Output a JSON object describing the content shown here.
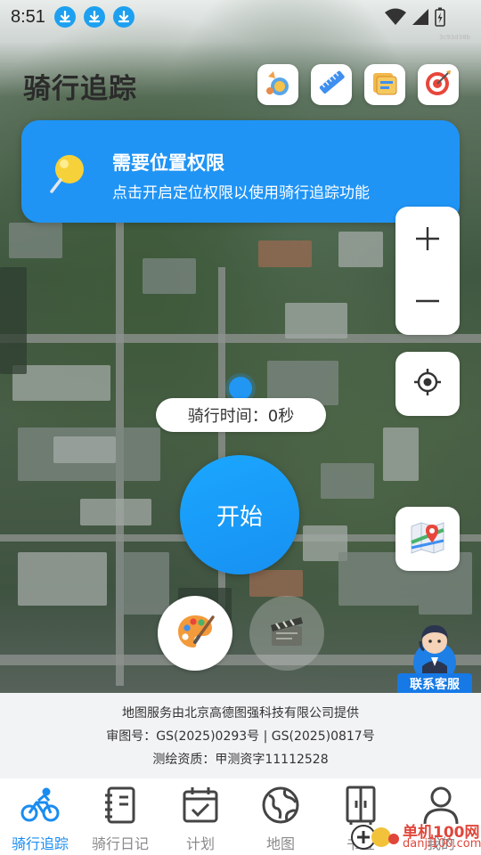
{
  "status_bar": {
    "time": "8:51",
    "icons": [
      "download-icon",
      "download-icon",
      "download-icon",
      "wifi-icon",
      "signal-icon",
      "battery-charging-icon"
    ],
    "tiny_text": "3c93d38b"
  },
  "header": {
    "title": "骑行追踪",
    "tools": [
      "achievement-icon",
      "ruler-icon",
      "folder-icon",
      "target-icon"
    ]
  },
  "banner": {
    "title": "需要位置权限",
    "description": "点击开启定位权限以使用骑行追踪功能"
  },
  "map_controls": {
    "zoom_in": "+",
    "zoom_out": "−"
  },
  "ride": {
    "time_label": "骑行时间：0秒",
    "start_label": "开始"
  },
  "customer_service": {
    "label": "联系客服"
  },
  "attribution": {
    "line1": "地图服务由北京高德图强科技有限公司提供",
    "line2": "审图号：GS(2025)0293号 | GS(2025)0817号",
    "line3": "测绘资质：甲测资字11112528"
  },
  "tabs": [
    {
      "label": "骑行追踪",
      "icon": "bicycle-icon",
      "active": true
    },
    {
      "label": "骑行日记",
      "icon": "notebook-icon",
      "active": false
    },
    {
      "label": "计划",
      "icon": "calendar-check-icon",
      "active": false
    },
    {
      "label": "地图",
      "icon": "globe-icon",
      "active": false
    },
    {
      "label": "书签",
      "icon": "wardrobe-icon",
      "active": false
    },
    {
      "label": "我的",
      "icon": "user-icon",
      "active": false
    }
  ],
  "site_watermark": {
    "line1": "单机100网",
    "line2": "danji100.com"
  },
  "colors": {
    "accent": "#1f94f5",
    "active_tab": "#1a8cf0"
  }
}
